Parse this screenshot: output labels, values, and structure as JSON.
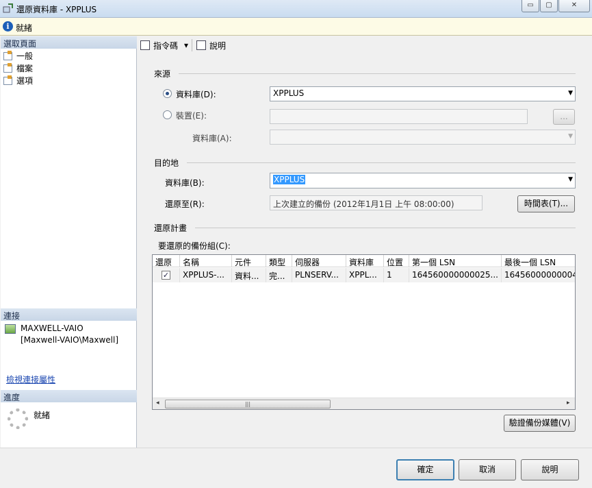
{
  "window": {
    "title": "還原資料庫 - XPPLUS",
    "minimize_glyph": "▭",
    "maximize_glyph": "▢",
    "close_glyph": "✕"
  },
  "status_bar": {
    "text": "就緒"
  },
  "left_panel": {
    "select_page_header": "選取頁面",
    "pages": [
      {
        "label": "一般"
      },
      {
        "label": "檔案"
      },
      {
        "label": "選項"
      }
    ],
    "connection_header": "連接",
    "server": "MAXWELL-VAIO",
    "user": "[Maxwell-VAIO\\Maxwell]",
    "view_properties_link": "檢視連接屬性",
    "progress_header": "進度",
    "progress_status": "就緒"
  },
  "toolbar": {
    "script_label": "指令碼",
    "script_dropdown": "▾",
    "help_label": "說明"
  },
  "source": {
    "group_label": "來源",
    "database_radio_label": "資料庫(D):",
    "database_value": "XPPLUS",
    "device_radio_label": "裝置(E):",
    "device_value": "",
    "browse_label": "...",
    "device_database_label": "資料庫(A):",
    "device_database_value": ""
  },
  "destination": {
    "group_label": "目的地",
    "database_label": "資料庫(B):",
    "database_value": "XPPLUS",
    "restore_to_label": "還原至(R):",
    "restore_to_value": "上次建立的備份 (2012年1月1日 上午 08:00:00)",
    "timeline_button": "時間表(T)..."
  },
  "restore_plan": {
    "group_label": "還原計畫",
    "backup_sets_label": "要還原的備份組(C):",
    "columns": [
      "還原",
      "名稱",
      "元件",
      "類型",
      "伺服器",
      "資料庫",
      "位置",
      "第一個 LSN",
      "最後一個 LSN"
    ],
    "rows": [
      {
        "restore": true,
        "check_glyph": "✓",
        "name": "XPPLUS-...",
        "component": "資料...",
        "type": "完...",
        "server": "PLNSERV...",
        "database": "XPPL...",
        "position": "1",
        "first_lsn": "164560000000025...",
        "last_lsn": "16456000000004..."
      }
    ],
    "scroll_left": "◂",
    "scroll_right": "▸",
    "scroll_grip": "|||",
    "verify_button": "驗證備份媒體(V)"
  },
  "footer": {
    "ok": "確定",
    "cancel": "取消",
    "help": "說明"
  }
}
